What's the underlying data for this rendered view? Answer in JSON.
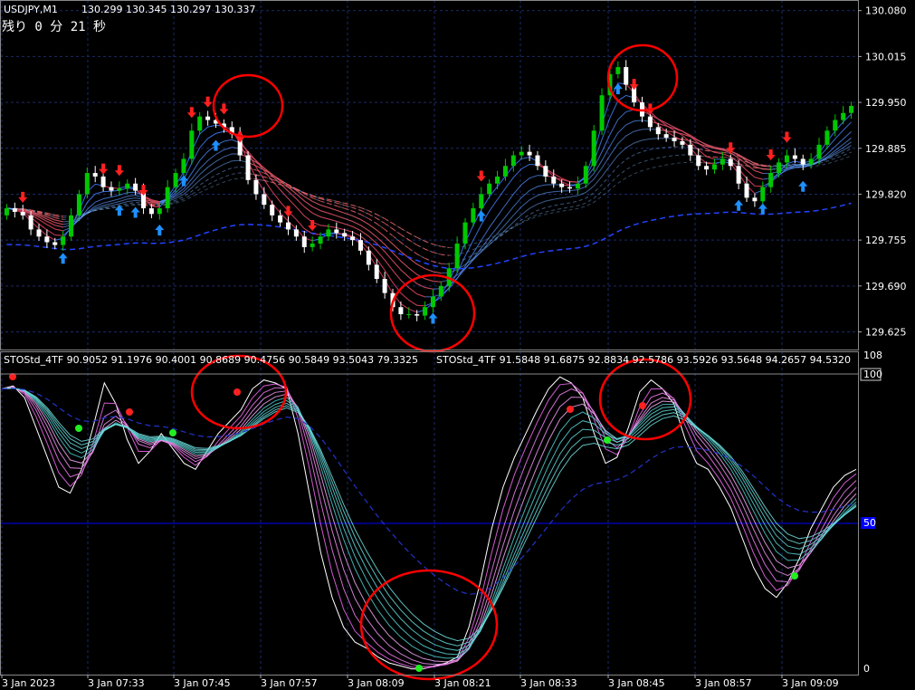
{
  "chart_data": [
    {
      "type": "candlestick",
      "symbol_header": "USDJPY,M1",
      "ohlc_header": "130.299 130.345 130.297 130.337",
      "countdown": "残り 0 分 21 秒",
      "y_ticks": [
        "130.080",
        "130.015",
        "129.950",
        "129.885",
        "129.820",
        "129.755",
        "129.690",
        "129.625"
      ],
      "y_tick_values": [
        130.08,
        130.015,
        129.95,
        129.885,
        129.82,
        129.755,
        129.69,
        129.625
      ],
      "ylim": [
        129.6,
        130.095
      ],
      "close": [
        129.8,
        129.795,
        129.79,
        129.77,
        129.76,
        129.752,
        129.748,
        129.76,
        129.79,
        129.82,
        129.85,
        129.845,
        129.83,
        129.825,
        129.828,
        129.835,
        129.825,
        129.8,
        129.792,
        129.8,
        129.83,
        129.85,
        129.87,
        129.91,
        129.93,
        129.925,
        129.92,
        129.915,
        129.905,
        129.875,
        129.84,
        129.82,
        129.805,
        129.79,
        129.78,
        129.77,
        129.76,
        129.745,
        129.75,
        129.76,
        129.77,
        129.765,
        129.76,
        129.755,
        129.74,
        129.72,
        129.7,
        129.68,
        129.66,
        129.65,
        129.65,
        129.648,
        129.66,
        129.675,
        129.69,
        129.715,
        129.75,
        129.78,
        129.8,
        129.82,
        129.835,
        129.845,
        129.86,
        129.875,
        129.88,
        129.875,
        129.86,
        129.845,
        129.835,
        129.83,
        129.828,
        129.835,
        129.86,
        129.91,
        129.96,
        129.99,
        130.0,
        129.975,
        129.95,
        129.93,
        129.915,
        129.905,
        129.9,
        129.895,
        129.89,
        129.875,
        129.86,
        129.855,
        129.862,
        129.87,
        129.86,
        129.835,
        129.815,
        129.81,
        129.83,
        129.85,
        129.865,
        129.875,
        129.87,
        129.862,
        129.87,
        129.89,
        129.91,
        129.925,
        129.935,
        129.945
      ],
      "rsi_label_1": "STOStd_4TF 90.9052 91.1976 90.4001 90.8689 90.4756 90.5849 93.5043 79.3325",
      "rsi_label_2": "STOStd_4TF 91.5848 91.6875 92.8834 92.5786 93.5926 93.5648 94.2657 94.5320",
      "sub_ticks": [
        "108",
        "100",
        "50",
        "0"
      ],
      "x_ticks": [
        "3 Jan 2023",
        "3 Jan 07:33",
        "3 Jan 07:45",
        "3 Jan 07:57",
        "3 Jan 08:09",
        "3 Jan 08:21",
        "3 Jan 08:33",
        "3 Jan 08:45",
        "3 Jan 08:57",
        "3 Jan 09:09"
      ],
      "stoch_main": [
        95,
        96,
        92,
        82,
        72,
        62,
        60,
        68,
        82,
        97,
        90,
        78,
        70,
        74,
        80,
        75,
        70,
        68,
        74,
        80,
        84,
        88,
        95,
        98,
        97,
        95,
        80,
        60,
        40,
        25,
        15,
        10,
        8,
        5,
        3,
        2,
        1,
        1,
        2,
        3,
        5,
        15,
        30,
        48,
        62,
        72,
        80,
        88,
        95,
        99,
        97,
        92,
        80,
        70,
        72,
        82,
        94,
        98,
        95,
        90,
        78,
        70,
        68,
        62,
        55,
        45,
        35,
        28,
        25,
        30,
        38,
        48,
        55,
        62,
        66,
        68
      ]
    }
  ],
  "colors": {
    "up_candle": "#00c800",
    "down_candle": "#ffffff",
    "arrow_up": "#1e90ff",
    "arrow_down": "#ff2020",
    "circle": "#ff0000",
    "grid": "#1a2a6a",
    "blue_mid": "#0000ff"
  }
}
